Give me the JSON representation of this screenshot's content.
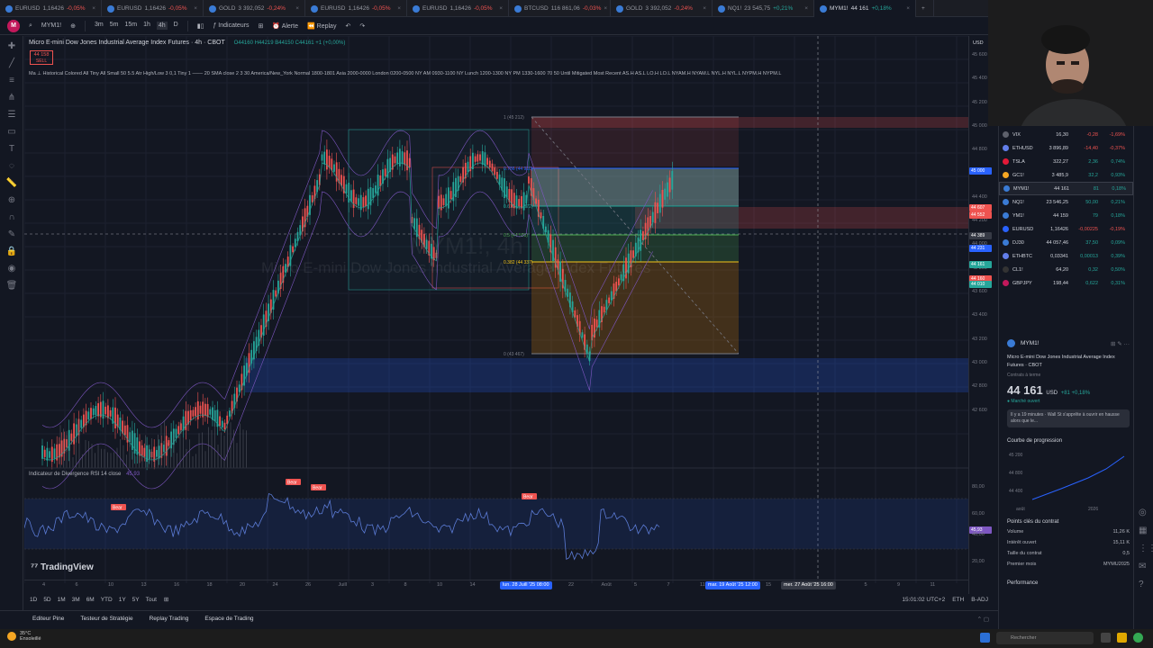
{
  "tabs": [
    {
      "symbol": "EURUSD",
      "price": "1,16426",
      "change": "-0,05%",
      "up": false
    },
    {
      "symbol": "EURUSD",
      "price": "1,16426",
      "change": "-0,05%",
      "up": false
    },
    {
      "symbol": "GOLD",
      "price": "3 392,052",
      "change": "-0,24%",
      "up": false
    },
    {
      "symbol": "EURUSD",
      "price": "1,16426",
      "change": "-0,05%",
      "up": false
    },
    {
      "symbol": "EURUSD",
      "price": "1,16426",
      "change": "-0,05%",
      "up": false
    },
    {
      "symbol": "BTCUSD",
      "price": "116 861,06",
      "change": "-0,03%",
      "up": false
    },
    {
      "symbol": "GOLD",
      "price": "3 392,052",
      "change": "-0,24%",
      "up": false
    },
    {
      "symbol": "NQ1!",
      "price": "23 545,75",
      "change": "+0,21%",
      "up": true
    },
    {
      "symbol": "MYM1!",
      "price": "44 161",
      "change": "+0,18%",
      "up": true
    }
  ],
  "toolbar": {
    "logo": "M",
    "symbol": "MYM1!",
    "intervals": [
      "3m",
      "5m",
      "15m",
      "1h",
      "4h",
      "D"
    ],
    "indicators": "Indicateurs",
    "alert": "Alerte",
    "replay": "Replay"
  },
  "header": {
    "title": "Micro E-mini Dow Jones Industrial Average Index Futures · 4h · CBOT",
    "ohlc": "O44160 H44219 B44150 C44161 +1 (+0,00%)",
    "indicators_line": "Ma ⊥  Historical Colored All Tiny All Small 50 5.5 Atr High/Low 3 0,1 Tiny 1 ─── 20 SMA close 2 3 30 America/New_York Normal 1800-1801 Asia 2000-0000 London 0200-0500 NY AM 0930-1100 NY Lunch 1200-1300 NY PM 1330-1600 70 50 Until Mitigated Most Recent AS.H AS.L LO.H LO.L NYAM.H NYAM.L NYL.H NYL.L NYPM.H NYPM.L",
    "sell_price": "44 158",
    "sell_label": "SELL",
    "currency": "USD"
  },
  "watermark": {
    "symbol": "MYM1!, 4h",
    "name": "Micro E-mini Dow Jones Industrial Average Index Futures"
  },
  "price_axis": [
    "45 600",
    "45 400",
    "45 200",
    "45 000",
    "44 800",
    "44 600",
    "44 400",
    "44 200",
    "44 000",
    "43 800",
    "43 600",
    "43 400",
    "43 200",
    "43 000",
    "42 800",
    "42 600"
  ],
  "price_tags": [
    {
      "value": "45 000",
      "color": "#2962ff"
    },
    {
      "value": "44 607",
      "color": "#ef5350"
    },
    {
      "value": "44 552",
      "color": "#ef5350"
    },
    {
      "value": "44 389",
      "color": "#363a45"
    },
    {
      "value": "44 231",
      "color": "#2962ff"
    },
    {
      "value": "44 161",
      "color": "#26a69a"
    },
    {
      "value": "44 160",
      "color": "#ef5350"
    },
    {
      "value": "44 010",
      "color": "#26a69a"
    }
  ],
  "rsi_axis": [
    "80,00",
    "60,00",
    "45,93",
    "40,00",
    "20,00"
  ],
  "rsi": {
    "label": "Indicateur de Divergence RSI 14 close",
    "value": "45,93",
    "bear_label": "Bear"
  },
  "fib_levels": [
    {
      "label": "1 (45 212)"
    },
    {
      "label": "0.786 (44 910)"
    },
    {
      "label": "0.618 (44 672)"
    },
    {
      "label": "0.5 (44 508)"
    },
    {
      "label": "0.382 (44 337)"
    },
    {
      "label": "0 (43 467)"
    }
  ],
  "time_axis": [
    "4",
    "6",
    "10",
    "13",
    "16",
    "18",
    "20",
    "24",
    "26",
    "Juill",
    "3",
    "8",
    "10",
    "14",
    "16",
    "18",
    "22",
    "Août",
    "5",
    "7",
    "11",
    "13",
    "15",
    "19",
    "3",
    "5",
    "9",
    "11"
  ],
  "time_selected": [
    "lun. 28 Juill '25  08:00",
    "mar. 19 Août '25  12:00",
    "mer. 27 Août '25  16:00"
  ],
  "bottom_ranges": [
    "1D",
    "5D",
    "1M",
    "3M",
    "6M",
    "YTD",
    "1Y",
    "5Y",
    "Tout"
  ],
  "bottom_right": {
    "time": "15:01:02 UTC+2",
    "session": "ETH",
    "adj": "B-ADJ"
  },
  "bottom_tabs": [
    "Editeur Pine",
    "Testeur de Stratégie",
    "Replay Trading",
    "Espace de Trading"
  ],
  "tv_logo": "TradingView",
  "watchlist": [
    {
      "symbol": "VIX",
      "last": "16,30",
      "chg": "-0,28",
      "chgp": "-1,69%",
      "up": false,
      "color": "#5d606b"
    },
    {
      "symbol": "ETHUSD",
      "last": "3 896,89",
      "chg": "-14,40",
      "chgp": "-0,37%",
      "up": false,
      "color": "#627eea"
    },
    {
      "symbol": "TSLA",
      "last": "322,27",
      "chg": "2,36",
      "chgp": "0,74%",
      "up": true,
      "color": "#e31937"
    },
    {
      "symbol": "GC1!",
      "last": "3 485,9",
      "chg": "32,2",
      "chgp": "0,93%",
      "up": true,
      "color": "#f5a623"
    },
    {
      "symbol": "MYM1!",
      "last": "44 161",
      "chg": "81",
      "chgp": "0,18%",
      "up": true,
      "color": "#3a7bd5"
    },
    {
      "symbol": "NQ1!",
      "last": "23 546,25",
      "chg": "50,00",
      "chgp": "0,21%",
      "up": true,
      "color": "#3a7bd5"
    },
    {
      "symbol": "YM1!",
      "last": "44 159",
      "chg": "79",
      "chgp": "0,18%",
      "up": true,
      "color": "#3a7bd5"
    },
    {
      "symbol": "EURUSD",
      "last": "1,16426",
      "chg": "-0,00225",
      "chgp": "-0,19%",
      "up": false,
      "color": "#2962ff"
    },
    {
      "symbol": "DJ30",
      "last": "44 057,46",
      "chg": "37,50",
      "chgp": "0,09%",
      "up": true,
      "color": "#3a7bd5"
    },
    {
      "symbol": "ETHBTC",
      "last": "0,03341",
      "chg": "0,00013",
      "chgp": "0,39%",
      "up": true,
      "color": "#627eea"
    },
    {
      "symbol": "CL1!",
      "last": "64,20",
      "chg": "0,32",
      "chgp": "0,50%",
      "up": true,
      "color": "#333"
    },
    {
      "symbol": "GBPJPY",
      "last": "198,44",
      "chg": "0,622",
      "chgp": "0,31%",
      "up": true,
      "color": "#c2185b"
    }
  ],
  "detail": {
    "symbol": "MYM1!",
    "name": "Micro E-mini Dow Jones Industrial Average Index Futures · CBOT",
    "sub": "Contrats à terme",
    "price": "44 161",
    "currency": "USD",
    "change": "+81  +0,18%",
    "market_status": "● Marché ouvert",
    "news": "Il y a 19 minutes · Wall St s'apprête à ouvrir en hausse alors que le...",
    "progress_title": "Courbe de progression",
    "progress_axis": [
      "45 200",
      "44 800",
      "44 400"
    ],
    "progress_x": [
      "août",
      "2026"
    ],
    "key_title": "Points clés du contrat",
    "key_values": [
      {
        "k": "Volume",
        "v": "11,26 K"
      },
      {
        "k": "Intérêt ouvert",
        "v": "15,11 K"
      },
      {
        "k": "Taille du contrat",
        "v": "0,5"
      },
      {
        "k": "Premier mois",
        "v": "MYMU2025"
      }
    ],
    "performance": "Performance"
  },
  "taskbar": {
    "temp": "35°C",
    "weather": "Ensoleillé",
    "search": "Rechercher"
  }
}
